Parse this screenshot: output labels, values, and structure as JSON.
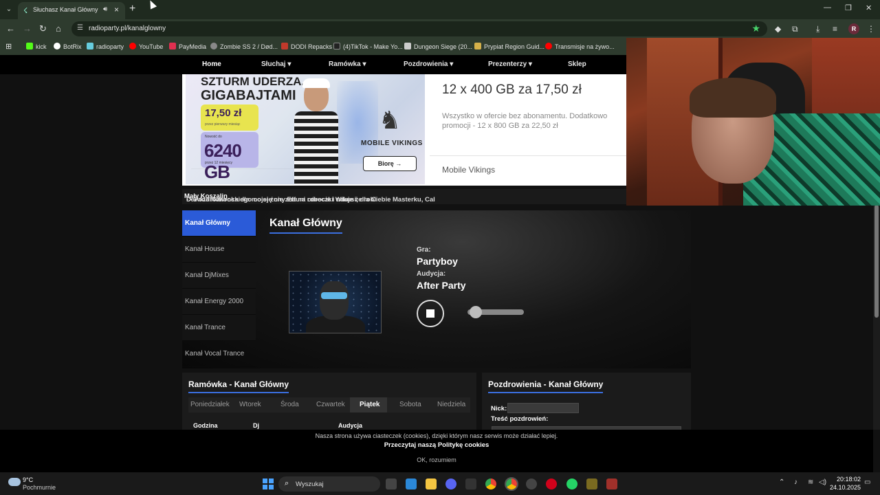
{
  "browser": {
    "tab_title": "Słuchasz Kanał Główny",
    "url": "radioparty.pl/kanalglowny",
    "bookmarks": [
      {
        "label": "kick",
        "color": "#53fc18"
      },
      {
        "label": "BotRix",
        "color": "#ffffff"
      },
      {
        "label": "radioparty",
        "color": "#66ccdd"
      },
      {
        "label": "YouTube",
        "color": "#ff0000"
      },
      {
        "label": "PayMedia",
        "color": "#e03050"
      },
      {
        "label": "Zombie SS 2 / Død...",
        "color": "#888888"
      },
      {
        "label": "DODI Repacks",
        "color": "#c0392b"
      },
      {
        "label": "(4)TikTok - Make Yo...",
        "color": "#222222"
      },
      {
        "label": "Dungeon Siege (20...",
        "color": "#cccccc"
      },
      {
        "label": "Prypiat Region Guid...",
        "color": "#d4b04a"
      },
      {
        "label": "Transmisje na żywo...",
        "color": "#ff0000"
      }
    ]
  },
  "site_nav": {
    "items": [
      "Home",
      "Słuchaj",
      "Ramówka",
      "Pozdrowienia",
      "Prezenterzy",
      "Sklep"
    ]
  },
  "ad": {
    "headline_1": "SZTURM UDERZA...",
    "headline_2": "GIGABAJTAMI",
    "price_1": "17,50 zł",
    "price_1_sub": "przez pierwszy miesiąc",
    "price_2_top": "Nowość do",
    "price_2": "6240 GB",
    "price_2_sub": "przez 12 miesięcy",
    "brand_name": "MOBILE VIKINGS",
    "cta": "Biorę",
    "title": "12 x 400 GB za 17,50 zł",
    "description": "Wszystko w ofercie bez abonamentu. Dodatkowo promocji - 12 x 800 GB za 22,50 zł",
    "advertiser": "Mobile Vikings"
  },
  "ticker": {
    "text_before": "Dawida Nawrockiego co się nie zna na robocie i udaje że robi ",
    "text_bold": "Mały Koszalin",
    "text_after": " -> Pozdrowionka dla mojej żony Effuni córeczki Wikusi, dla Ciebie Masterku, Cal"
  },
  "player": {
    "channels": [
      "Kanał Główny",
      "Kanał House",
      "Kanał DjMixes",
      "Kanał Energy 2000",
      "Kanał Trance",
      "Kanał Vocal Trance"
    ],
    "active_channel": "Kanał Główny",
    "title": "Kanał Główny",
    "plays_label": "Gra:",
    "plays_value": "Partyboy",
    "show_label": "Audycja:",
    "show_value": "After Party",
    "volume": 0.05
  },
  "schedule": {
    "title": "Ramówka - Kanał Główny",
    "days": [
      "Poniedziałek",
      "Wtorek",
      "Środa",
      "Czwartek",
      "Piątek",
      "Sobota",
      "Niedziela"
    ],
    "active_day": "Piątek",
    "columns": [
      "Godzina",
      "Dj",
      "Audycja"
    ]
  },
  "greetings": {
    "title": "Pozdrowienia - Kanał Główny",
    "nick_label": "Nick:",
    "message_label": "Treść pozdrowień:"
  },
  "cookies": {
    "notice": "Nasza strona używa ciasteczek (cookies), dzięki którym nasz serwis może działać lepiej.",
    "policy_link": "Przeczytaj naszą Politykę cookies",
    "ok_button": "OK, rozumiem"
  },
  "taskbar": {
    "temperature": "9°C",
    "weather": "Pochmurnie",
    "search_placeholder": "Wyszukaj",
    "time": "20:18:02",
    "date": "24.10.2025"
  }
}
